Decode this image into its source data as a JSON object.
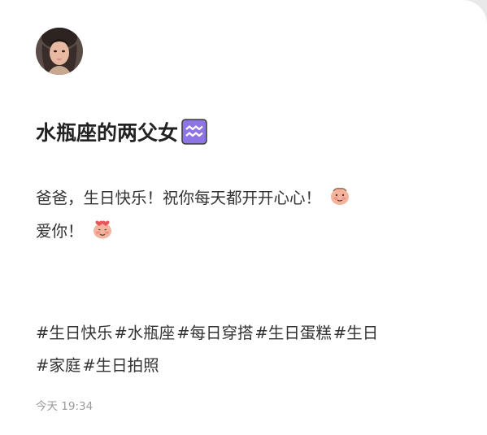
{
  "post": {
    "title": "水瓶座的两父女",
    "body_line1": "爸爸，生日快乐！祝你每天都开开心心！",
    "body_line2": "爱你！",
    "tags": [
      "#生日快乐",
      "#水瓶座",
      "#每日穿搭",
      "#生日蛋糕",
      "#生日",
      "#家庭",
      "#生日拍照"
    ],
    "timestamp": "今天 19:34"
  },
  "icons": {
    "avatar": "user-avatar-photo",
    "title_emoji": "aquarius-emoji",
    "face_emoji": "blushing-face-emoji",
    "love_emoji": "love-face-emoji"
  },
  "colors": {
    "aquarius_bg": "#8d75e6",
    "face": "#f4b39d"
  }
}
